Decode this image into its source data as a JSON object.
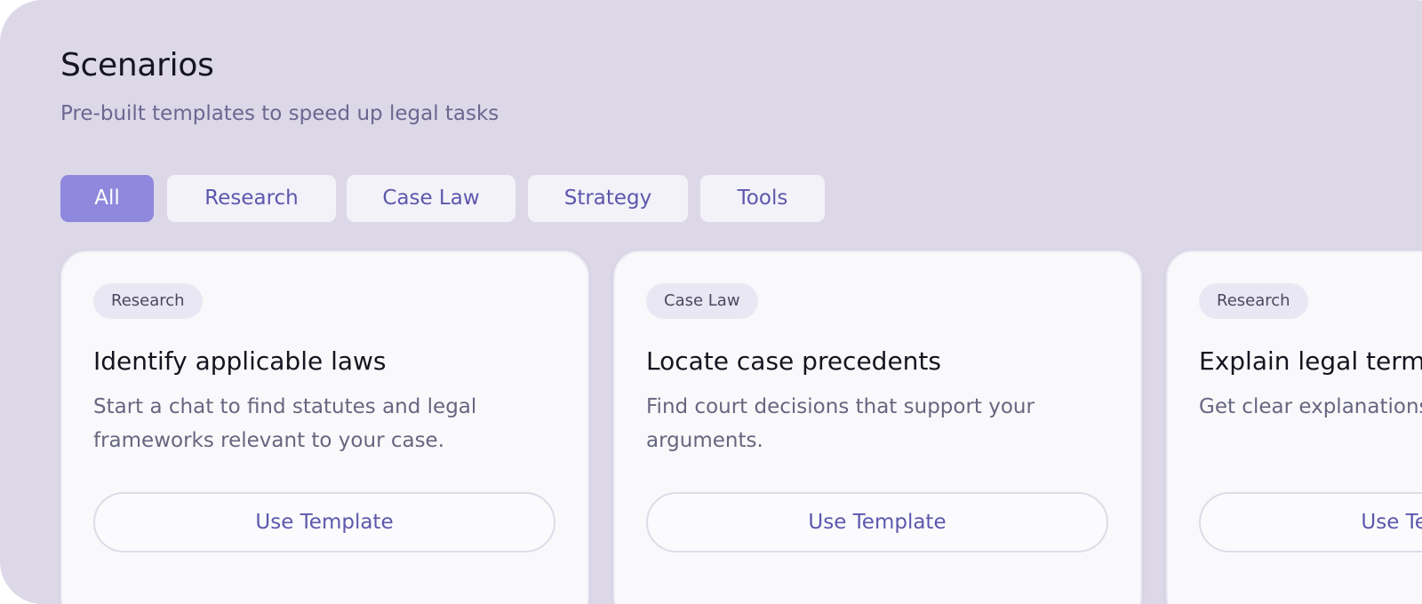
{
  "header": {
    "title": "Scenarios",
    "subtitle": "Pre-built templates to speed up legal tasks"
  },
  "filters": [
    {
      "label": "All",
      "active": true
    },
    {
      "label": "Research",
      "active": false
    },
    {
      "label": "Case Law",
      "active": false
    },
    {
      "label": "Strategy",
      "active": false
    },
    {
      "label": "Tools",
      "active": false
    }
  ],
  "cards": [
    {
      "tag": "Research",
      "title": "Identify applicable laws",
      "description": "Start a chat to find statutes and legal frameworks relevant to your case.",
      "button_label": "Use Template"
    },
    {
      "tag": "Case Law",
      "title": "Locate case precedents",
      "description": "Find court decisions that support your arguments.",
      "button_label": "Use Template"
    },
    {
      "tag": "Research",
      "title": "Explain legal terms",
      "description": "Get clear explanations of legal concepts.",
      "button_label": "Use Template"
    }
  ],
  "colors": {
    "background": "#dcd8e8",
    "accent": "#8e89dc",
    "accent_text": "#5d57ad",
    "card": "#f9f9fb"
  }
}
